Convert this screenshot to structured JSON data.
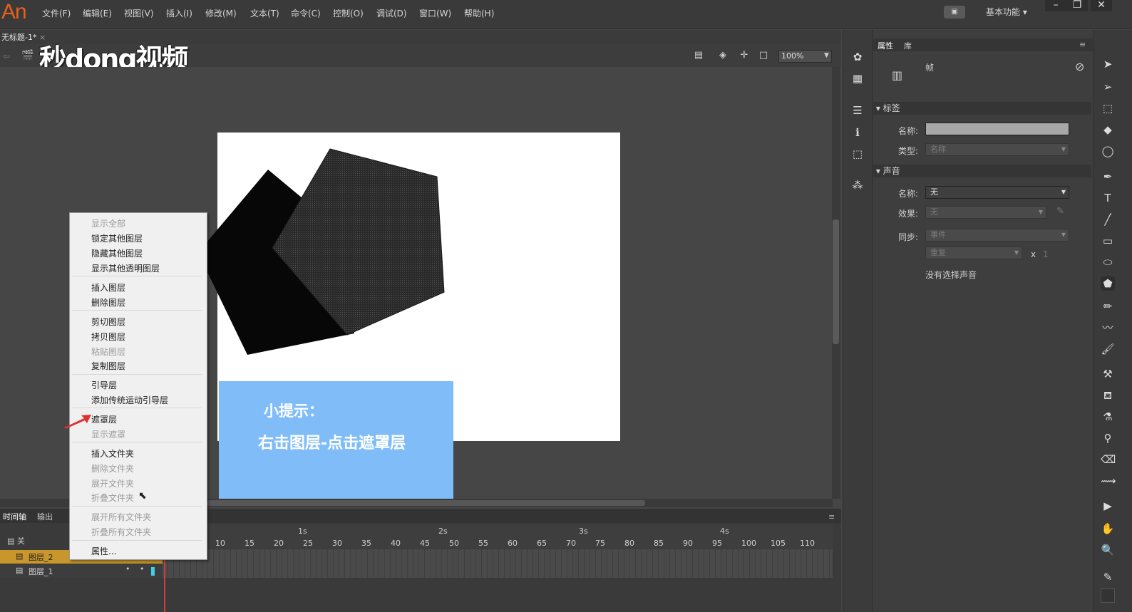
{
  "app": {
    "logo": "An"
  },
  "menus": [
    "文件(F)",
    "编辑(E)",
    "视图(V)",
    "插入(I)",
    "修改(M)",
    "文本(T)",
    "命令(C)",
    "控制(O)",
    "调试(D)",
    "窗口(W)",
    "帮助(H)"
  ],
  "workspace": {
    "label": "基本功能",
    "arrow": "▾"
  },
  "window_controls": {
    "minimize": "–",
    "restore": "❐",
    "close": "✕"
  },
  "document": {
    "tab_title": "无标题-1*",
    "tab_close": "×"
  },
  "watermark": "秒dong视频",
  "stage_toolbar": {
    "zoom": "100%"
  },
  "tip": {
    "title": "小提示：",
    "body": "右击图层-点击遮罩层"
  },
  "timeline": {
    "tabs": [
      "时间轴",
      "输出"
    ],
    "header_label": "关",
    "ruler_seconds": [
      "1s",
      "2s",
      "3s",
      "4s"
    ],
    "ruler_frames": [
      "10",
      "15",
      "20",
      "25",
      "30",
      "35",
      "40",
      "45",
      "50",
      "55",
      "60",
      "65",
      "70",
      "75",
      "80",
      "85",
      "90",
      "95",
      "100",
      "105",
      "110"
    ],
    "layers": [
      {
        "name": "图层_2",
        "selected": true
      },
      {
        "name": "图层_1",
        "selected": false
      }
    ]
  },
  "context_menu": {
    "items": [
      {
        "label": "显示全部",
        "enabled": false
      },
      {
        "label": "锁定其他图层",
        "enabled": true
      },
      {
        "label": "隐藏其他图层",
        "enabled": true
      },
      {
        "label": "显示其他透明图层",
        "enabled": true
      },
      {
        "label": "插入图层",
        "enabled": true
      },
      {
        "label": "删除图层",
        "enabled": true
      },
      {
        "label": "剪切图层",
        "enabled": true
      },
      {
        "label": "拷贝图层",
        "enabled": true
      },
      {
        "label": "粘贴图层",
        "enabled": false
      },
      {
        "label": "复制图层",
        "enabled": true
      },
      {
        "label": "引导层",
        "enabled": true
      },
      {
        "label": "添加传统运动引导层",
        "enabled": true
      },
      {
        "label": "遮罩层",
        "enabled": true
      },
      {
        "label": "显示遮罩",
        "enabled": false
      },
      {
        "label": "插入文件夹",
        "enabled": true
      },
      {
        "label": "删除文件夹",
        "enabled": false
      },
      {
        "label": "展开文件夹",
        "enabled": false
      },
      {
        "label": "折叠文件夹",
        "enabled": false
      },
      {
        "label": "展开所有文件夹",
        "enabled": false
      },
      {
        "label": "折叠所有文件夹",
        "enabled": false
      },
      {
        "label": "属性...",
        "enabled": true
      }
    ]
  },
  "properties": {
    "tabs": [
      "属性",
      "库"
    ],
    "kind": "帧",
    "label_section": {
      "title": "标签",
      "name_label": "名称:",
      "name_value": "",
      "type_label": "类型:",
      "type_value": "名称"
    },
    "sound_section": {
      "title": "声音",
      "name_label": "名称:",
      "name_value": "无",
      "effect_label": "效果:",
      "effect_value": "无",
      "sync_label": "同步:",
      "sync_value": "事件",
      "repeat_value": "重复",
      "repeat_x": "x",
      "repeat_count": "1",
      "status": "没有选择声音"
    }
  },
  "colors": {
    "accent_logo": "#e8601c",
    "tip_box": "#80bdf8",
    "selected_layer": "#c8962b"
  }
}
